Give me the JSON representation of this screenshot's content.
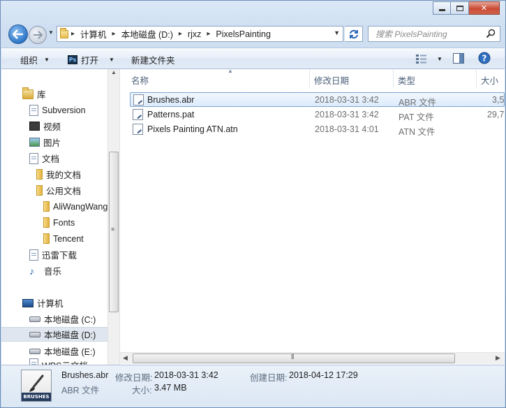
{
  "window": {
    "caption": {
      "minimize": "minimize",
      "maximize": "maximize",
      "close": "✕"
    }
  },
  "address": {
    "crumbs": [
      "计算机",
      "本地磁盘 (D:)",
      "rjxz",
      "PixelsPainting"
    ],
    "search_placeholder": "搜索 PixelsPainting"
  },
  "toolbar": {
    "organize": "组织",
    "open": "打开",
    "new_folder": "新建文件夹"
  },
  "nav": {
    "items": [
      {
        "label": "库",
        "icon": "library-icon"
      },
      {
        "label": "Subversion",
        "icon": "subversion-icon"
      },
      {
        "label": "视频",
        "icon": "video-icon"
      },
      {
        "label": "图片",
        "icon": "picture-icon"
      },
      {
        "label": "文档",
        "icon": "document-icon"
      },
      {
        "label": "我的文档",
        "icon": "folder-icon"
      },
      {
        "label": "公用文档",
        "icon": "folder-icon"
      },
      {
        "label": "AliWangWang",
        "icon": "folder-icon"
      },
      {
        "label": "Fonts",
        "icon": "folder-icon"
      },
      {
        "label": "Tencent",
        "icon": "folder-icon"
      },
      {
        "label": "迅雷下载",
        "icon": "download-icon"
      },
      {
        "label": "音乐",
        "icon": "music-icon"
      },
      {
        "label": "计算机",
        "icon": "computer-icon"
      },
      {
        "label": "本地磁盘 (C:)",
        "icon": "drive-icon"
      },
      {
        "label": "本地磁盘 (D:)",
        "icon": "drive-icon"
      },
      {
        "label": "本地磁盘 (E:)",
        "icon": "drive-icon"
      },
      {
        "label": "WPS云文档",
        "icon": "cloud-icon"
      }
    ]
  },
  "files": {
    "columns": {
      "name": "名称",
      "modified": "修改日期",
      "type": "类型",
      "size": "大小"
    },
    "rows": [
      {
        "name": "Brushes.abr",
        "modified": "2018-03-31 3:42",
        "type": "ABR 文件",
        "size": "3,5"
      },
      {
        "name": "Patterns.pat",
        "modified": "2018-03-31 3:42",
        "type": "PAT 文件",
        "size": "29,7"
      },
      {
        "name": "Pixels Painting ATN.atn",
        "modified": "2018-03-31 4:01",
        "type": "ATN 文件",
        "size": ""
      }
    ]
  },
  "details": {
    "thumb_label": "BRUSHES",
    "name": "Brushes.abr",
    "type": "ABR 文件",
    "modified_label": "修改日期:",
    "modified": "2018-03-31 3:42",
    "created_label": "创建日期:",
    "created": "2018-04-12 17:29",
    "size_label": "大小:",
    "size": "3.47 MB"
  }
}
